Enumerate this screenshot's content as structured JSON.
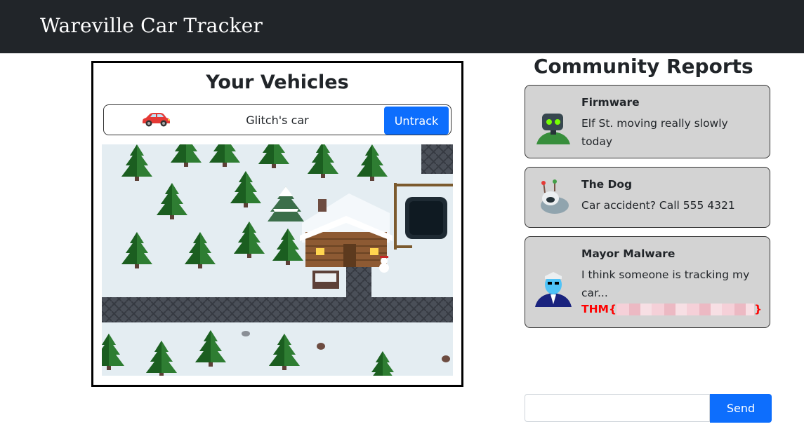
{
  "navbar": {
    "brand": "Wareville Car Tracker"
  },
  "vehicles": {
    "title": "Your Vehicles",
    "items": [
      {
        "name": "Glitch's car",
        "icon": "car-icon",
        "action_label": "Untrack"
      }
    ]
  },
  "reports": {
    "title": "Community Reports",
    "items": [
      {
        "author": "Firmware",
        "message": "Elf St. moving really slowly today",
        "avatar": "robot-avatar"
      },
      {
        "author": "The Dog",
        "message": "Car accident? Call 555 4321",
        "avatar": "dog-avatar"
      },
      {
        "author": "Mayor Malware",
        "message": "I think someone is tracking my car...",
        "flag_prefix": "THM{",
        "flag_suffix": "}",
        "avatar": "mayor-avatar"
      }
    ]
  },
  "chat": {
    "input_value": "",
    "send_label": "Send"
  },
  "colors": {
    "navbar": "#212529",
    "primary": "#0d6efd",
    "card_bg": "#d3d3d3",
    "flag": "#ff0000"
  }
}
